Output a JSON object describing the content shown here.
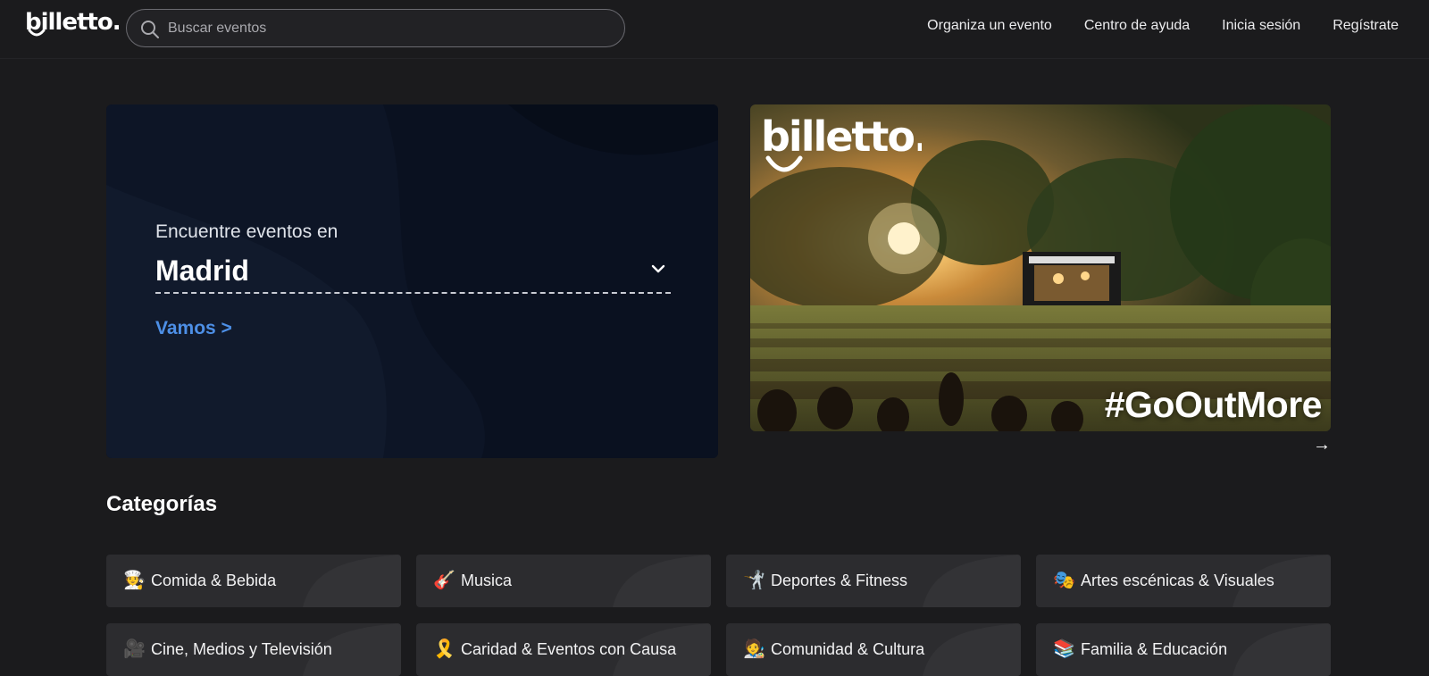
{
  "header": {
    "logo_alt": "billetto.",
    "search_placeholder": "Buscar eventos",
    "nav": [
      "Organiza un evento",
      "Centro de ayuda",
      "Inicia sesión",
      "Regístrate"
    ]
  },
  "hero": {
    "find_label": "Encuentre eventos en",
    "city": "Madrid",
    "go_label": "Vamos >"
  },
  "banner": {
    "logo": "billetto.",
    "tagline": "#GoOutMore",
    "next_icon": "→"
  },
  "categories": {
    "title": "Categorías",
    "items": [
      {
        "emoji": "🧑‍🍳",
        "label": "Comida & Bebida"
      },
      {
        "emoji": "🎸",
        "label": "Musica"
      },
      {
        "emoji": "🤺",
        "label": "Deportes & Fitness"
      },
      {
        "emoji": "🎭",
        "label": "Artes escénicas & Visuales"
      },
      {
        "emoji": "🎥",
        "label": "Cine, Medios y Televisión"
      },
      {
        "emoji": "🎗️",
        "label": "Caridad & Eventos con Causa"
      },
      {
        "emoji": "🧑‍🎨",
        "label": "Comunidad & Cultura"
      },
      {
        "emoji": "📚",
        "label": "Familia & Educación"
      }
    ]
  },
  "colors": {
    "background": "#1b1b1d",
    "card": "#2c2c2f",
    "hero_bg": "#0b1220",
    "accent_link": "#4d8fe6"
  }
}
